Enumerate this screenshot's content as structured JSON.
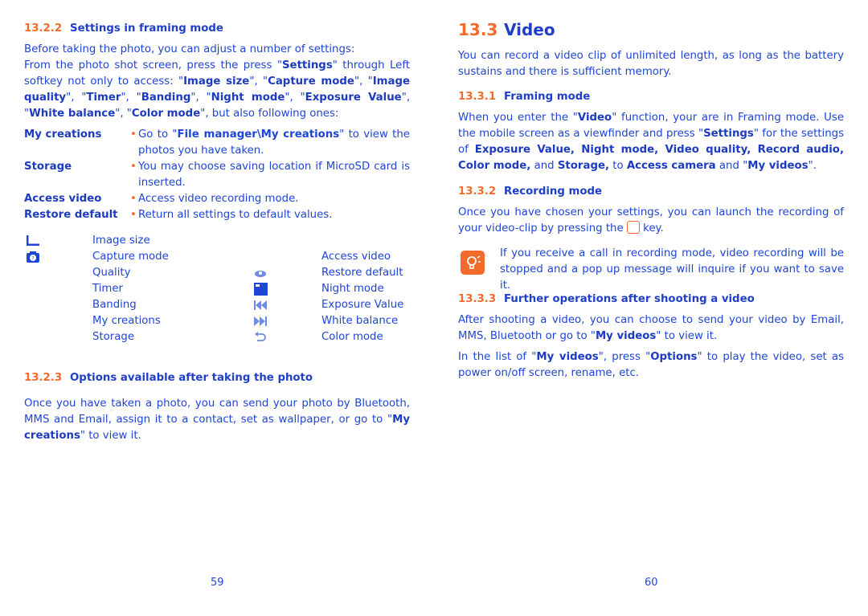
{
  "left": {
    "h_1322": {
      "num": "13.2.2",
      "title": "Settings in framing mode"
    },
    "intro1": "Before taking the photo, you can adjust a number of settings:",
    "intro2_html": "From the photo shot screen, press the press \"<b>Settings</b>\" through Left softkey not only to access: \"<b>Image size</b>\", \"<b>Capture mode</b>\", \"<b>Image quality</b>\", \"<b>Timer</b>\", \"<b>Banding</b>\", \"<b>Night mode</b>\", \"<b>Exposure Value</b>\", \"<b>White balance</b>\", \"<b>Color mode</b>\", but also following ones:",
    "defs": [
      {
        "term": "My creations",
        "desc_html": "Go to \"<b>File manager\\My creations</b>\" to view the photos you have taken."
      },
      {
        "term": "Storage",
        "desc_html": "You may choose saving location if MicroSD card is inserted."
      },
      {
        "term": "Access video",
        "desc_html": "Access video recording mode."
      },
      {
        "term": "Restore default",
        "desc_html": "Return all settings to default values."
      }
    ],
    "icons_col1": [
      {
        "icon": "image-size-icon",
        "label": "Image size"
      },
      {
        "icon": "capture-mode-icon",
        "label": "Capture mode"
      },
      {
        "icon": "",
        "label": "Quality"
      },
      {
        "icon": "",
        "label": "Timer"
      },
      {
        "icon": "",
        "label": "Banding"
      },
      {
        "icon": "",
        "label": "My creations"
      },
      {
        "icon": "",
        "label": "Storage"
      }
    ],
    "icons_col2": [
      {
        "icon": "",
        "label": "Access video"
      },
      {
        "icon": "restore-default-icon",
        "label": "Restore default"
      },
      {
        "icon": "night-mode-icon",
        "label": "Night mode"
      },
      {
        "icon": "rewind-icon",
        "label": "Exposure Value"
      },
      {
        "icon": "fast-forward-icon",
        "label": "White balance"
      },
      {
        "icon": "undo-icon",
        "label": "Color mode"
      }
    ],
    "h_1323": {
      "num": "13.2.3",
      "title": "Options available after taking the photo"
    },
    "options_html": "Once you have taken a photo, you can send your photo by Bluetooth, MMS and Email, assign it to a contact, set as wallpaper, or go to \"<b>My creations</b>\" to view it.",
    "page_number": "59"
  },
  "right": {
    "h_133": {
      "num": "13.3",
      "title": "Video"
    },
    "intro": "You can record a video clip of unlimited length, as long as the battery sustains and there is sufficient memory.",
    "h_1331": {
      "num": "13.3.1",
      "title": "Framing mode"
    },
    "framing_html": "When you enter the \"<b>Video</b>\" function, your are in Framing mode. Use the mobile screen as a viewfinder and press \"<b>Settings</b>\" for the settings of <b>Exposure Value, Night mode, Video quality, Record audio, Color mode,</b> and <b>Storage,</b> to <b>Access camera</b> and \"<b>My videos</b>\".",
    "h_1332": {
      "num": "13.3.2",
      "title": "Recording mode"
    },
    "recording_pre": "Once you have chosen your settings, you can launch the recording of your video-clip by pressing the",
    "recording_post": "key.",
    "tip": "If you receive a call in recording mode, video recording will be stopped and a pop up message will inquire if you want to save it.",
    "h_1333": {
      "num": "13.3.3",
      "title": "Further operations after shooting a video"
    },
    "further1_html": "After shooting a video, you can choose to send your video by Email, MMS, Bluetooth or go to \"<b>My videos</b>\" to view it.",
    "further2_html": "In the list of \"<b>My videos</b>\", press \"<b>Options</b>\" to play the video, set as power on/off screen, rename, etc.",
    "page_number": "60"
  }
}
